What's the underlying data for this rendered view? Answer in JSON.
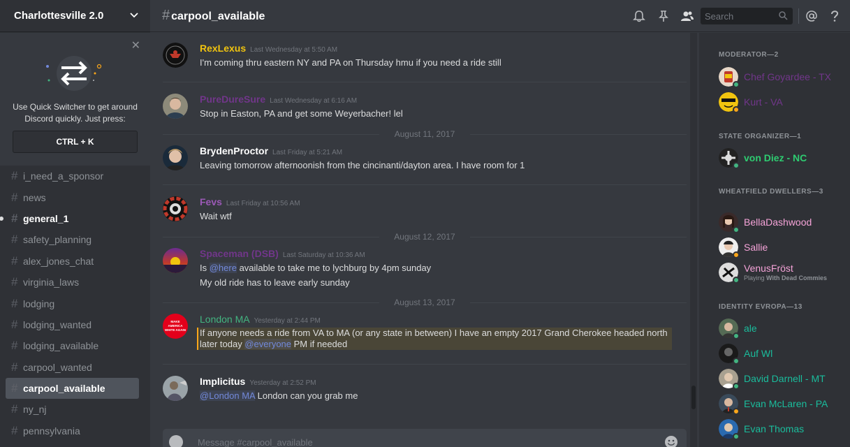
{
  "server": {
    "name": "Charlottesville 2.0"
  },
  "quick_switcher": {
    "text_line1": "Use Quick Switcher to get around",
    "text_line2": "Discord quickly. Just press:",
    "shortcut": "CTRL + K"
  },
  "channels": [
    {
      "name": "i_need_a_sponsor",
      "state": "normal"
    },
    {
      "name": "news",
      "state": "normal"
    },
    {
      "name": "general_1",
      "state": "unread"
    },
    {
      "name": "safety_planning",
      "state": "normal"
    },
    {
      "name": "alex_jones_chat",
      "state": "normal"
    },
    {
      "name": "virginia_laws",
      "state": "normal"
    },
    {
      "name": "lodging",
      "state": "normal"
    },
    {
      "name": "lodging_wanted",
      "state": "normal"
    },
    {
      "name": "lodging_available",
      "state": "normal"
    },
    {
      "name": "carpool_wanted",
      "state": "normal"
    },
    {
      "name": "carpool_available",
      "state": "selected"
    },
    {
      "name": "ny_nj",
      "state": "normal"
    },
    {
      "name": "pennsylvania",
      "state": "normal"
    }
  ],
  "topbar": {
    "channel_name": "carpool_available",
    "search_placeholder": "Search"
  },
  "messages": [
    {
      "author": "RexLexus",
      "color": "#f1c40f",
      "timestamp": "Last Wednesday at 5:50 AM",
      "lines": [
        "I'm coming thru eastern NY and PA on Thursday hmu if you need a ride still"
      ]
    },
    {
      "author": "PureDureSure",
      "color": "#71368a",
      "timestamp": "Last Wednesday at 6:16 AM",
      "lines": [
        "Stop in Easton, PA and get some Weyerbacher! lel"
      ]
    },
    {
      "author": "BrydenProctor",
      "color": "#ffffff",
      "timestamp": "Last Friday at 5:21 AM",
      "lines": [
        "Leaving tomorrow afternoonish from the cincinanti/dayton area. I have room for 1"
      ]
    },
    {
      "author": "Fevs",
      "color": "#9b59b6",
      "timestamp": "Last Friday at 10:56 AM",
      "lines": [
        "Wait wtf"
      ]
    },
    {
      "author": "Spaceman (DSB)",
      "color": "#71368a",
      "timestamp": "Last Saturday at 10:36 AM",
      "lines": [
        "available to take me to lychburg by 4pm sunday",
        "My old ride has to leave early sunday"
      ],
      "mention": "@here"
    },
    {
      "author": "London MA",
      "color": "#43b581",
      "timestamp": "Yesterday at 2:44 PM",
      "lines": [
        "If anyone needs a ride from VA to MA (or any state in between) I have an empty 2017 Grand Cherokee headed north",
        "later today",
        "PM if needed"
      ],
      "mention": "@everyone"
    },
    {
      "author": "Implicitus",
      "color": "#ffffff",
      "timestamp": "Yesterday at 2:52 PM",
      "lines": [
        "London can you grab me"
      ],
      "mention": "@London MA"
    }
  ],
  "date_dividers": [
    "August 11, 2017",
    "August 12, 2017",
    "August 13, 2017"
  ],
  "avatar_texts": {
    "london": "MAKE AMERICA WHITE AGAIN"
  },
  "composer": {
    "placeholder": "Message #carpool_available"
  },
  "members": {
    "roles": [
      "MODERATOR—2",
      "STATE ORGANIZER—1",
      "WHEATFIELD DWELLERS—3",
      "IDENTITY EVROPA—13"
    ],
    "list": [
      {
        "name": "Chef Goyardee - TX",
        "color": "#71368a",
        "status": "#43b581"
      },
      {
        "name": "Kurt - VA",
        "color": "#71368a",
        "status": "#faa61a"
      },
      {
        "name": "von Diez - NC",
        "color": "#2ecc71",
        "status": "#43b581"
      },
      {
        "name": "BellaDashwood",
        "color": "#f5a3d8",
        "status": "#43b581"
      },
      {
        "name": "Sallie",
        "color": "#f5a3d8",
        "status": "#faa61a"
      },
      {
        "name": "VenusFröst",
        "color": "#f5a3d8",
        "status": "#43b581",
        "activity_prefix": "Playing",
        "activity": "With Dead Commies"
      },
      {
        "name": "ale",
        "color": "#1abc9c",
        "status": "#43b581"
      },
      {
        "name": "Auf Wl",
        "color": "#1abc9c",
        "status": "#43b581"
      },
      {
        "name": "David Darnell - MT",
        "color": "#1abc9c",
        "status": "#43b581"
      },
      {
        "name": "Evan McLaren - PA",
        "color": "#1abc9c",
        "status": "#faa61a"
      },
      {
        "name": "Evan Thomas",
        "color": "#1abc9c",
        "status": "#43b581"
      }
    ]
  }
}
